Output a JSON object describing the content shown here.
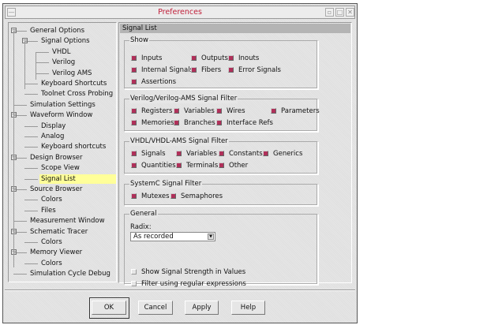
{
  "window": {
    "title": "Preferences"
  },
  "tree": {
    "items": [
      {
        "label": "General Options",
        "level": 0,
        "expander": "minus"
      },
      {
        "label": "Signal Options",
        "level": 1,
        "expander": "minus"
      },
      {
        "label": "VHDL",
        "level": 2
      },
      {
        "label": "Verilog",
        "level": 2
      },
      {
        "label": "Verilog AMS",
        "level": 2
      },
      {
        "label": "Keyboard Shortcuts",
        "level": 1
      },
      {
        "label": "Toolnet Cross Probing",
        "level": 1
      },
      {
        "label": "Simulation Settings",
        "level": 0
      },
      {
        "label": "Waveform Window",
        "level": 0,
        "expander": "minus"
      },
      {
        "label": "Display",
        "level": 1
      },
      {
        "label": "Analog",
        "level": 1
      },
      {
        "label": "Keyboard shortcuts",
        "level": 1
      },
      {
        "label": "Design Browser",
        "level": 0,
        "expander": "minus"
      },
      {
        "label": "Scope View",
        "level": 1
      },
      {
        "label": "Signal List",
        "level": 1,
        "selected": true
      },
      {
        "label": "Source Browser",
        "level": 0,
        "expander": "minus"
      },
      {
        "label": "Colors",
        "level": 1
      },
      {
        "label": "Files",
        "level": 1
      },
      {
        "label": "Measurement Window",
        "level": 0
      },
      {
        "label": "Schematic Tracer",
        "level": 0,
        "expander": "minus"
      },
      {
        "label": "Colors",
        "level": 1
      },
      {
        "label": "Memory Viewer",
        "level": 0,
        "expander": "minus"
      },
      {
        "label": "Colors",
        "level": 1
      },
      {
        "label": "Simulation Cycle Debug",
        "level": 0
      }
    ]
  },
  "panel": {
    "title": "Signal List",
    "groups": [
      {
        "title": "Show",
        "items": [
          {
            "label": "Inputs",
            "checked": true
          },
          {
            "label": "Outputs",
            "checked": true
          },
          {
            "label": "Inouts",
            "checked": true
          },
          {
            "label": "Internal Signals",
            "checked": true
          },
          {
            "label": "Fibers",
            "checked": true
          },
          {
            "label": "Error Signals",
            "checked": true
          },
          {
            "label": "Assertions",
            "checked": true
          }
        ]
      },
      {
        "title": "Verilog/Verilog-AMS Signal Filter",
        "items": [
          {
            "label": "Registers",
            "checked": true
          },
          {
            "label": "Variables",
            "checked": true
          },
          {
            "label": "Wires",
            "checked": true
          },
          {
            "label": "Parameters",
            "checked": true
          },
          {
            "label": "Memories",
            "checked": true
          },
          {
            "label": "Branches",
            "checked": true
          },
          {
            "label": "Interface Refs",
            "checked": true
          }
        ]
      },
      {
        "title": "VHDL/VHDL-AMS Signal Filter",
        "items": [
          {
            "label": "Signals",
            "checked": true
          },
          {
            "label": "Variables",
            "checked": true
          },
          {
            "label": "Constants",
            "checked": true
          },
          {
            "label": "Generics",
            "checked": true
          },
          {
            "label": "Quantities",
            "checked": true
          },
          {
            "label": "Terminals",
            "checked": true
          },
          {
            "label": "Other",
            "checked": true
          }
        ]
      },
      {
        "title": "SystemC Signal Filter",
        "items": [
          {
            "label": "Mutexes",
            "checked": true
          },
          {
            "label": "Semaphores",
            "checked": true
          }
        ]
      },
      {
        "title": "General",
        "items": [
          {
            "label": "Show Signal Strength in Values",
            "checked": false
          },
          {
            "label": "Filter using regular expressions",
            "checked": false
          }
        ]
      }
    ],
    "radix_label": "Radix:",
    "radix_value": "As recorded"
  },
  "buttons": {
    "ok": "OK",
    "cancel": "Cancel",
    "apply": "Apply",
    "help": "Help"
  },
  "colors": {
    "checked": "#b0305a",
    "title": "#c0203a",
    "selection": "#ffff99"
  }
}
